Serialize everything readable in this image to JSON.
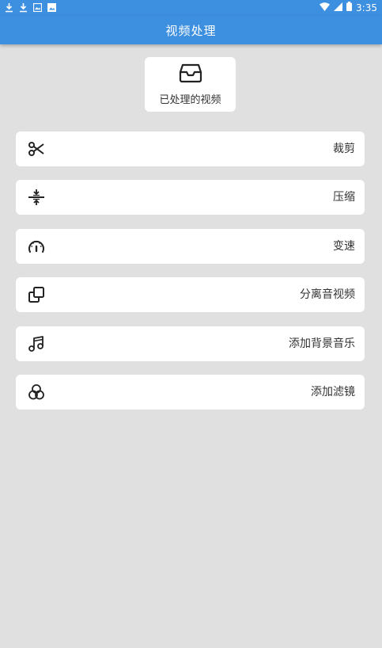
{
  "statusbar": {
    "time": "3:35",
    "left_icons": [
      "download-icon",
      "download-icon",
      "image-icon",
      "photo-icon"
    ],
    "right_icons": [
      "wifi-icon",
      "signal-icon",
      "battery-icon"
    ]
  },
  "appbar": {
    "title": "视频处理"
  },
  "processed": {
    "label": "已处理的视频",
    "icon": "inbox-tray-icon"
  },
  "menu": [
    {
      "label": "裁剪",
      "icon": "scissors-icon"
    },
    {
      "label": "压缩",
      "icon": "compress-icon"
    },
    {
      "label": "变速",
      "icon": "speedometer-icon"
    },
    {
      "label": "分离音视频",
      "icon": "copy-icon"
    },
    {
      "label": "添加背景音乐",
      "icon": "music-note-icon"
    },
    {
      "label": "添加滤镜",
      "icon": "filter-circles-icon"
    }
  ],
  "colors": {
    "primary": "#3d8fe0",
    "background": "#e0e0e0",
    "card": "#ffffff",
    "text": "#333333"
  }
}
